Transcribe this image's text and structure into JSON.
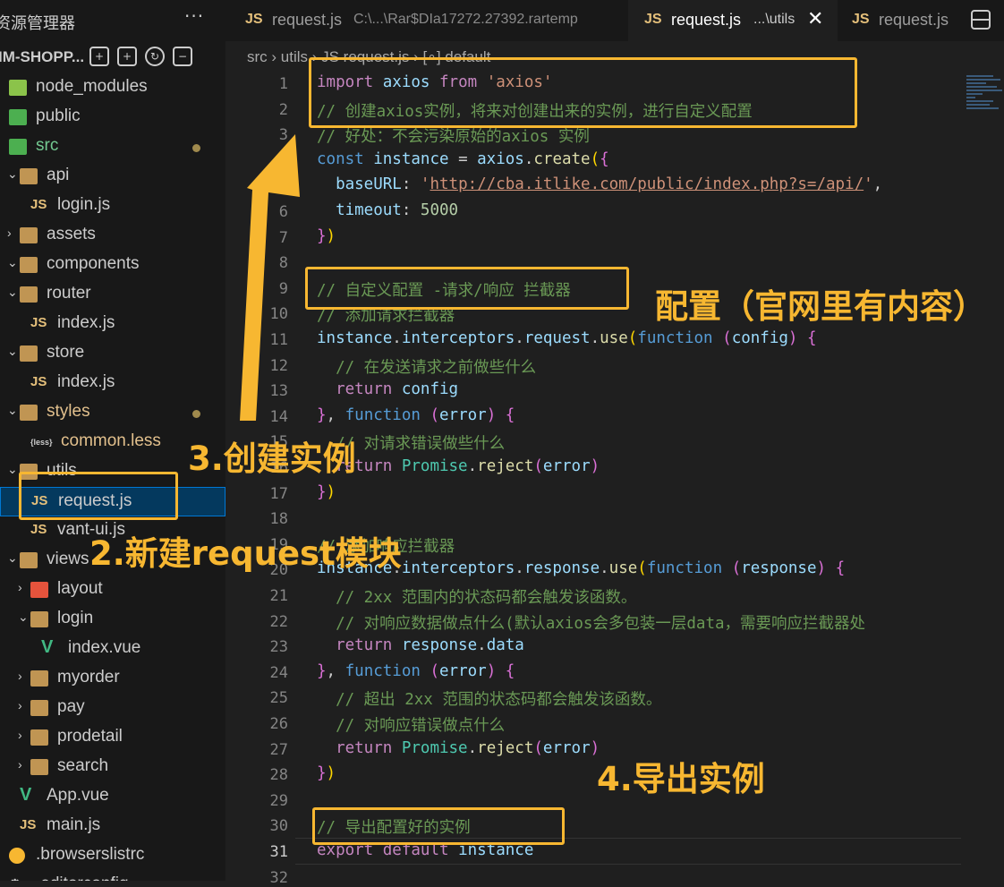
{
  "explorer": {
    "title": "资源管理器",
    "more": "···",
    "project": "IM-SHOPP...",
    "tree": [
      {
        "label": "node_modules",
        "type": "folder-node",
        "indent": 0,
        "chev": ""
      },
      {
        "label": "public",
        "type": "folder-public",
        "indent": 0,
        "chev": ""
      },
      {
        "label": "src",
        "type": "folder-src",
        "indent": 0,
        "chev": "",
        "color": "#73c991",
        "modified": true
      },
      {
        "label": "api",
        "type": "folder",
        "indent": 1,
        "chev": "⌄"
      },
      {
        "label": "login.js",
        "type": "js",
        "indent": 2,
        "chev": ""
      },
      {
        "label": "assets",
        "type": "folder",
        "indent": 1,
        "chev": "›"
      },
      {
        "label": "components",
        "type": "folder",
        "indent": 1,
        "chev": "⌄"
      },
      {
        "label": "router",
        "type": "folder",
        "indent": 1,
        "chev": "⌄"
      },
      {
        "label": "index.js",
        "type": "js",
        "indent": 2,
        "chev": ""
      },
      {
        "label": "store",
        "type": "folder",
        "indent": 1,
        "chev": "⌄"
      },
      {
        "label": "index.js",
        "type": "js",
        "indent": 2,
        "chev": ""
      },
      {
        "label": "styles",
        "type": "folder",
        "indent": 1,
        "chev": "⌄",
        "color": "#e2c08d",
        "modified": true
      },
      {
        "label": "common.less",
        "type": "less",
        "indent": 2,
        "chev": "",
        "color": "#e2c08d"
      },
      {
        "label": "utils",
        "type": "folder",
        "indent": 1,
        "chev": "⌄"
      },
      {
        "label": "request.js",
        "type": "js",
        "indent": 2,
        "chev": "",
        "selected": true
      },
      {
        "label": "vant-ui.js",
        "type": "js",
        "indent": 2,
        "chev": ""
      },
      {
        "label": "views",
        "type": "folder",
        "indent": 1,
        "chev": "⌄"
      },
      {
        "label": "layout",
        "type": "folder-red",
        "indent": 2,
        "chev": "›"
      },
      {
        "label": "login",
        "type": "folder",
        "indent": 2,
        "chev": "⌄"
      },
      {
        "label": "index.vue",
        "type": "vue",
        "indent": 3,
        "chev": ""
      },
      {
        "label": "myorder",
        "type": "folder",
        "indent": 2,
        "chev": "›"
      },
      {
        "label": "pay",
        "type": "folder",
        "indent": 2,
        "chev": "›"
      },
      {
        "label": "prodetail",
        "type": "folder",
        "indent": 2,
        "chev": "›"
      },
      {
        "label": "search",
        "type": "folder",
        "indent": 2,
        "chev": "›"
      },
      {
        "label": "App.vue",
        "type": "vue",
        "indent": 1,
        "chev": ""
      },
      {
        "label": "main.js",
        "type": "js",
        "indent": 1,
        "chev": ""
      },
      {
        "label": ".browserslistrc",
        "type": "browsers",
        "indent": 0,
        "chev": ""
      },
      {
        "label": ".editorconfig",
        "type": "gear",
        "indent": 0,
        "chev": ""
      }
    ]
  },
  "tabs": [
    {
      "icon": "JS",
      "label": "request.js",
      "sub": "C:\\...\\Rar$DIa17272.27392.rartemp",
      "active": false
    },
    {
      "icon": "JS",
      "label": "request.js",
      "sub": "...\\utils",
      "active": true,
      "close": "✕"
    },
    {
      "icon": "JS",
      "label": "request.js",
      "sub": "",
      "active": false
    }
  ],
  "breadcrumb": "src  ›  utils  ›  JS  request.js  ›  [∘]  default",
  "editor": {
    "current_line": 31,
    "lines": [
      {
        "n": "1",
        "html": [
          [
            "kw2",
            "import"
          ],
          [
            "pn",
            " "
          ],
          [
            "id",
            "axios"
          ],
          [
            "pn",
            " "
          ],
          [
            "kw2",
            "from"
          ],
          [
            "pn",
            " "
          ],
          [
            "str",
            "'axios'"
          ]
        ]
      },
      {
        "n": "2",
        "html": [
          [
            "cm",
            "// 创建axios实例，将来对创建出来的实例，进行自定义配置"
          ]
        ]
      },
      {
        "n": "3",
        "html": [
          [
            "cm",
            "// 好处：不会污染原始的axios 实例"
          ]
        ]
      },
      {
        "n": "4",
        "html": [
          [
            "kw",
            "const"
          ],
          [
            "pn",
            " "
          ],
          [
            "id",
            "instance"
          ],
          [
            "pn",
            " = "
          ],
          [
            "id",
            "axios"
          ],
          [
            "pn",
            "."
          ],
          [
            "fn",
            "create"
          ],
          [
            "br",
            "("
          ],
          [
            "br2",
            "{"
          ]
        ]
      },
      {
        "n": "5",
        "html": [
          [
            "pn",
            "  "
          ],
          [
            "id",
            "baseURL"
          ],
          [
            "pn",
            ": "
          ],
          [
            "str",
            "'"
          ],
          [
            "str url",
            "http://cba.itlike.com/public/index.php?s=/api/"
          ],
          [
            "str",
            "'"
          ],
          [
            "pn",
            ","
          ]
        ]
      },
      {
        "n": "6",
        "html": [
          [
            "pn",
            "  "
          ],
          [
            "id",
            "timeout"
          ],
          [
            "pn",
            ": "
          ],
          [
            "num",
            "5000"
          ]
        ]
      },
      {
        "n": "7",
        "html": [
          [
            "br2",
            "}"
          ],
          [
            "br",
            ")"
          ]
        ]
      },
      {
        "n": "8",
        "html": []
      },
      {
        "n": "9",
        "html": [
          [
            "cm",
            "// 自定义配置 -请求/响应 拦截器"
          ]
        ]
      },
      {
        "n": "10",
        "html": [
          [
            "cm",
            "// 添加请求拦截器"
          ]
        ]
      },
      {
        "n": "11",
        "html": [
          [
            "id",
            "instance"
          ],
          [
            "pn",
            "."
          ],
          [
            "id",
            "interceptors"
          ],
          [
            "pn",
            "."
          ],
          [
            "id",
            "request"
          ],
          [
            "pn",
            "."
          ],
          [
            "fn",
            "use"
          ],
          [
            "br",
            "("
          ],
          [
            "kw",
            "function"
          ],
          [
            "pn",
            " "
          ],
          [
            "br2",
            "("
          ],
          [
            "id",
            "config"
          ],
          [
            "br2",
            ")"
          ],
          [
            "pn",
            " "
          ],
          [
            "br2",
            "{"
          ]
        ]
      },
      {
        "n": "12",
        "html": [
          [
            "pn",
            "  "
          ],
          [
            "cm",
            "// 在发送请求之前做些什么"
          ]
        ]
      },
      {
        "n": "13",
        "html": [
          [
            "pn",
            "  "
          ],
          [
            "kw2",
            "return"
          ],
          [
            "pn",
            " "
          ],
          [
            "id",
            "config"
          ]
        ]
      },
      {
        "n": "14",
        "html": [
          [
            "br2",
            "}"
          ],
          [
            "pn",
            ", "
          ],
          [
            "kw",
            "function"
          ],
          [
            "pn",
            " "
          ],
          [
            "br2",
            "("
          ],
          [
            "id",
            "error"
          ],
          [
            "br2",
            ")"
          ],
          [
            "pn",
            " "
          ],
          [
            "br2",
            "{"
          ]
        ]
      },
      {
        "n": "15",
        "html": [
          [
            "pn",
            "  "
          ],
          [
            "cm",
            "// 对请求错误做些什么"
          ]
        ]
      },
      {
        "n": "16",
        "html": [
          [
            "pn",
            "  "
          ],
          [
            "kw2",
            "return"
          ],
          [
            "pn",
            " "
          ],
          [
            "cls",
            "Promise"
          ],
          [
            "pn",
            "."
          ],
          [
            "fn",
            "reject"
          ],
          [
            "br2",
            "("
          ],
          [
            "id",
            "error"
          ],
          [
            "br2",
            ")"
          ]
        ]
      },
      {
        "n": "17",
        "html": [
          [
            "br2",
            "}"
          ],
          [
            "br",
            ")"
          ]
        ]
      },
      {
        "n": "18",
        "html": []
      },
      {
        "n": "19",
        "html": [
          [
            "cm",
            "// 添加响应拦截器"
          ]
        ]
      },
      {
        "n": "20",
        "html": [
          [
            "id",
            "instance"
          ],
          [
            "pn",
            "."
          ],
          [
            "id",
            "interceptors"
          ],
          [
            "pn",
            "."
          ],
          [
            "id",
            "response"
          ],
          [
            "pn",
            "."
          ],
          [
            "fn",
            "use"
          ],
          [
            "br",
            "("
          ],
          [
            "kw",
            "function"
          ],
          [
            "pn",
            " "
          ],
          [
            "br2",
            "("
          ],
          [
            "id",
            "response"
          ],
          [
            "br2",
            ")"
          ],
          [
            "pn",
            " "
          ],
          [
            "br2",
            "{"
          ]
        ]
      },
      {
        "n": "21",
        "html": [
          [
            "pn",
            "  "
          ],
          [
            "cm",
            "// 2xx 范围内的状态码都会触发该函数。"
          ]
        ]
      },
      {
        "n": "22",
        "html": [
          [
            "pn",
            "  "
          ],
          [
            "cm",
            "// 对响应数据做点什么(默认axios会多包装一层data，需要响应拦截器处"
          ]
        ]
      },
      {
        "n": "23",
        "html": [
          [
            "pn",
            "  "
          ],
          [
            "kw2",
            "return"
          ],
          [
            "pn",
            " "
          ],
          [
            "id",
            "response"
          ],
          [
            "pn",
            "."
          ],
          [
            "id",
            "data"
          ]
        ]
      },
      {
        "n": "24",
        "html": [
          [
            "br2",
            "}"
          ],
          [
            "pn",
            ", "
          ],
          [
            "kw",
            "function"
          ],
          [
            "pn",
            " "
          ],
          [
            "br2",
            "("
          ],
          [
            "id",
            "error"
          ],
          [
            "br2",
            ")"
          ],
          [
            "pn",
            " "
          ],
          [
            "br2",
            "{"
          ]
        ]
      },
      {
        "n": "25",
        "html": [
          [
            "pn",
            "  "
          ],
          [
            "cm",
            "// 超出 2xx 范围的状态码都会触发该函数。"
          ]
        ]
      },
      {
        "n": "26",
        "html": [
          [
            "pn",
            "  "
          ],
          [
            "cm",
            "// 对响应错误做点什么"
          ]
        ]
      },
      {
        "n": "27",
        "html": [
          [
            "pn",
            "  "
          ],
          [
            "kw2",
            "return"
          ],
          [
            "pn",
            " "
          ],
          [
            "cls",
            "Promise"
          ],
          [
            "pn",
            "."
          ],
          [
            "fn",
            "reject"
          ],
          [
            "br2",
            "("
          ],
          [
            "id",
            "error"
          ],
          [
            "br2",
            ")"
          ]
        ]
      },
      {
        "n": "28",
        "html": [
          [
            "br2",
            "}"
          ],
          [
            "br",
            ")"
          ]
        ]
      },
      {
        "n": "29",
        "html": []
      },
      {
        "n": "30",
        "html": [
          [
            "cm",
            "// 导出配置好的实例"
          ]
        ]
      },
      {
        "n": "31",
        "html": [
          [
            "kw2",
            "export"
          ],
          [
            "pn",
            " "
          ],
          [
            "kw2",
            "default"
          ],
          [
            "pn",
            " "
          ],
          [
            "id",
            "instance"
          ]
        ]
      },
      {
        "n": "32",
        "html": []
      }
    ]
  },
  "annotations": {
    "a1": "配置（官网里有内容）",
    "a2": "3.创建实例",
    "a3": "2.新建request模块",
    "a4": "4.导出实例",
    "color": "#f7b731"
  }
}
